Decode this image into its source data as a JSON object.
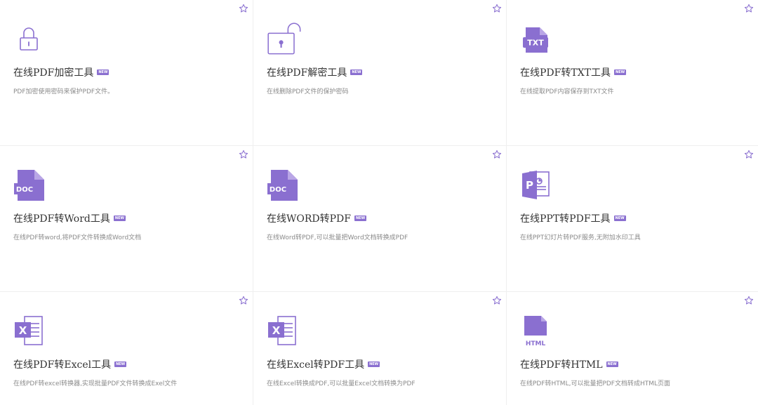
{
  "badge_text": "NEW",
  "accent_color": "#8a6fd0",
  "cards": [
    {
      "title": "在线PDF加密工具",
      "desc": "PDF加密使用密码来保护PDF文件。",
      "icon": "lock-icon"
    },
    {
      "title": "在线PDF解密工具",
      "desc": "在线删除PDF文件的保护密码",
      "icon": "unlock-icon"
    },
    {
      "title": "在线PDF转TXT工具",
      "desc": "在线提取PDF内容保存到TXT文件",
      "icon": "txt-file-icon"
    },
    {
      "title": "在线PDF转Word工具",
      "desc": "在线PDF转word,将PDF文件转换成Word文档",
      "icon": "doc-file-icon"
    },
    {
      "title": "在线WORD转PDF",
      "desc": "在线Word转PDF,可以批量把Word文档转换成PDF",
      "icon": "doc-file-icon"
    },
    {
      "title": "在线PPT转PDF工具",
      "desc": "在线PPT幻灯片转PDF服务,无附加水印工具",
      "icon": "ppt-file-icon"
    },
    {
      "title": "在线PDF转Excel工具",
      "desc": "在线PDF转excel转换器,实现批量PDF文件转换成Exel文件",
      "icon": "excel-file-icon"
    },
    {
      "title": "在线Excel转PDF工具",
      "desc": "在线Excel转换成PDF,可以批量Excel文档转换为PDF",
      "icon": "excel-file-icon"
    },
    {
      "title": "在线PDF转HTML",
      "desc": "在线PDF转HTML,可以批量把PDF文档转成HTML页面",
      "icon": "html-file-icon"
    }
  ]
}
